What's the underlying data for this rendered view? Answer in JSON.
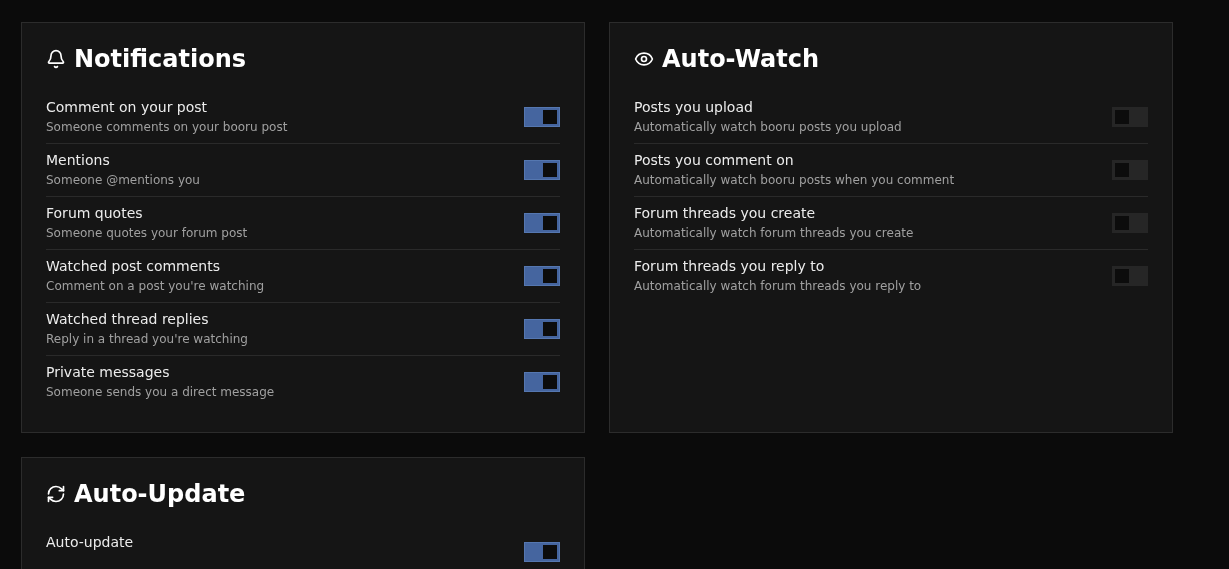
{
  "sections": [
    {
      "title": "Notifications",
      "items": [
        {
          "label": "Comment on your post",
          "description": "Someone comments on your booru post",
          "on": true
        },
        {
          "label": "Mentions",
          "description": "Someone @mentions you",
          "on": true
        },
        {
          "label": "Forum quotes",
          "description": "Someone quotes your forum post",
          "on": true
        },
        {
          "label": "Watched post comments",
          "description": "Comment on a post you're watching",
          "on": true
        },
        {
          "label": "Watched thread replies",
          "description": "Reply in a thread you're watching",
          "on": true
        },
        {
          "label": "Private messages",
          "description": "Someone sends you a direct message",
          "on": true
        }
      ]
    },
    {
      "title": "Auto-Watch",
      "items": [
        {
          "label": "Posts you upload",
          "description": "Automatically watch booru posts you upload",
          "on": false
        },
        {
          "label": "Posts you comment on",
          "description": "Automatically watch booru posts when you comment",
          "on": false
        },
        {
          "label": "Forum threads you create",
          "description": "Automatically watch forum threads you create",
          "on": false
        },
        {
          "label": "Forum threads you reply to",
          "description": "Automatically watch forum threads you reply to",
          "on": false
        }
      ]
    },
    {
      "title": "Auto-Update",
      "items": [
        {
          "label": "Auto-update",
          "on": true
        }
      ]
    }
  ]
}
